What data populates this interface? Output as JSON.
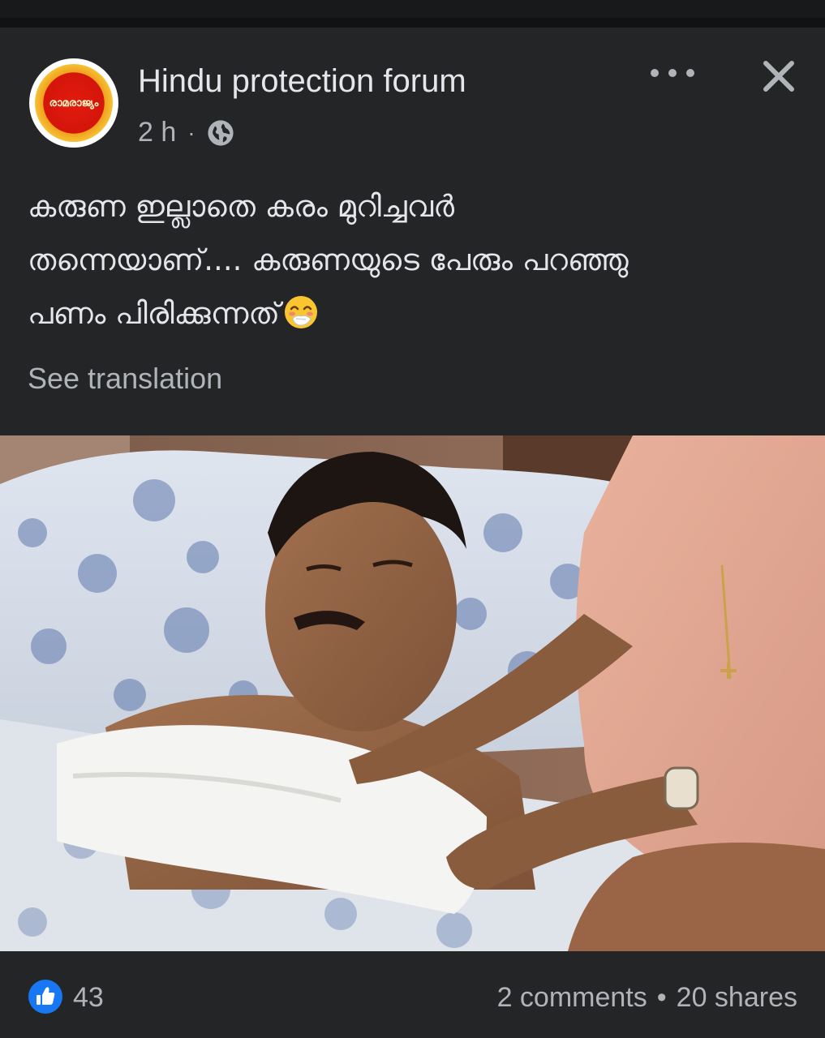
{
  "post": {
    "page_name": "Hindu protection forum",
    "avatar_text": "രാമരാജ്യം",
    "time": "2 h",
    "separator": "·",
    "audience_icon": "globe-icon",
    "more_icon": "more-horizontal-icon",
    "close_icon": "close-icon",
    "text_lines": [
      "കരുണ ഇല്ലാതെ കരം മുറിച്ചവർ",
      "തന്നെയാണ്.... കരുണയുടെ പേരും പറഞ്ഞു",
      "പണം പിരിക്കുന്നത്"
    ],
    "text_emoji": "face-with-hand-over-mouth-emoji",
    "see_translation": "See translation",
    "photo_icon": "post-photo"
  },
  "footer": {
    "reaction_icon": "like-icon",
    "like_count": "43",
    "comments": "2 comments",
    "dot": "•",
    "shares": "20 shares"
  },
  "colors": {
    "background": "#18191a",
    "card": "#242526",
    "primary_text": "#e4e6eb",
    "secondary_text": "#b0b3b8",
    "like_blue": "#1877f2",
    "avatar_red": "#d4150a"
  }
}
